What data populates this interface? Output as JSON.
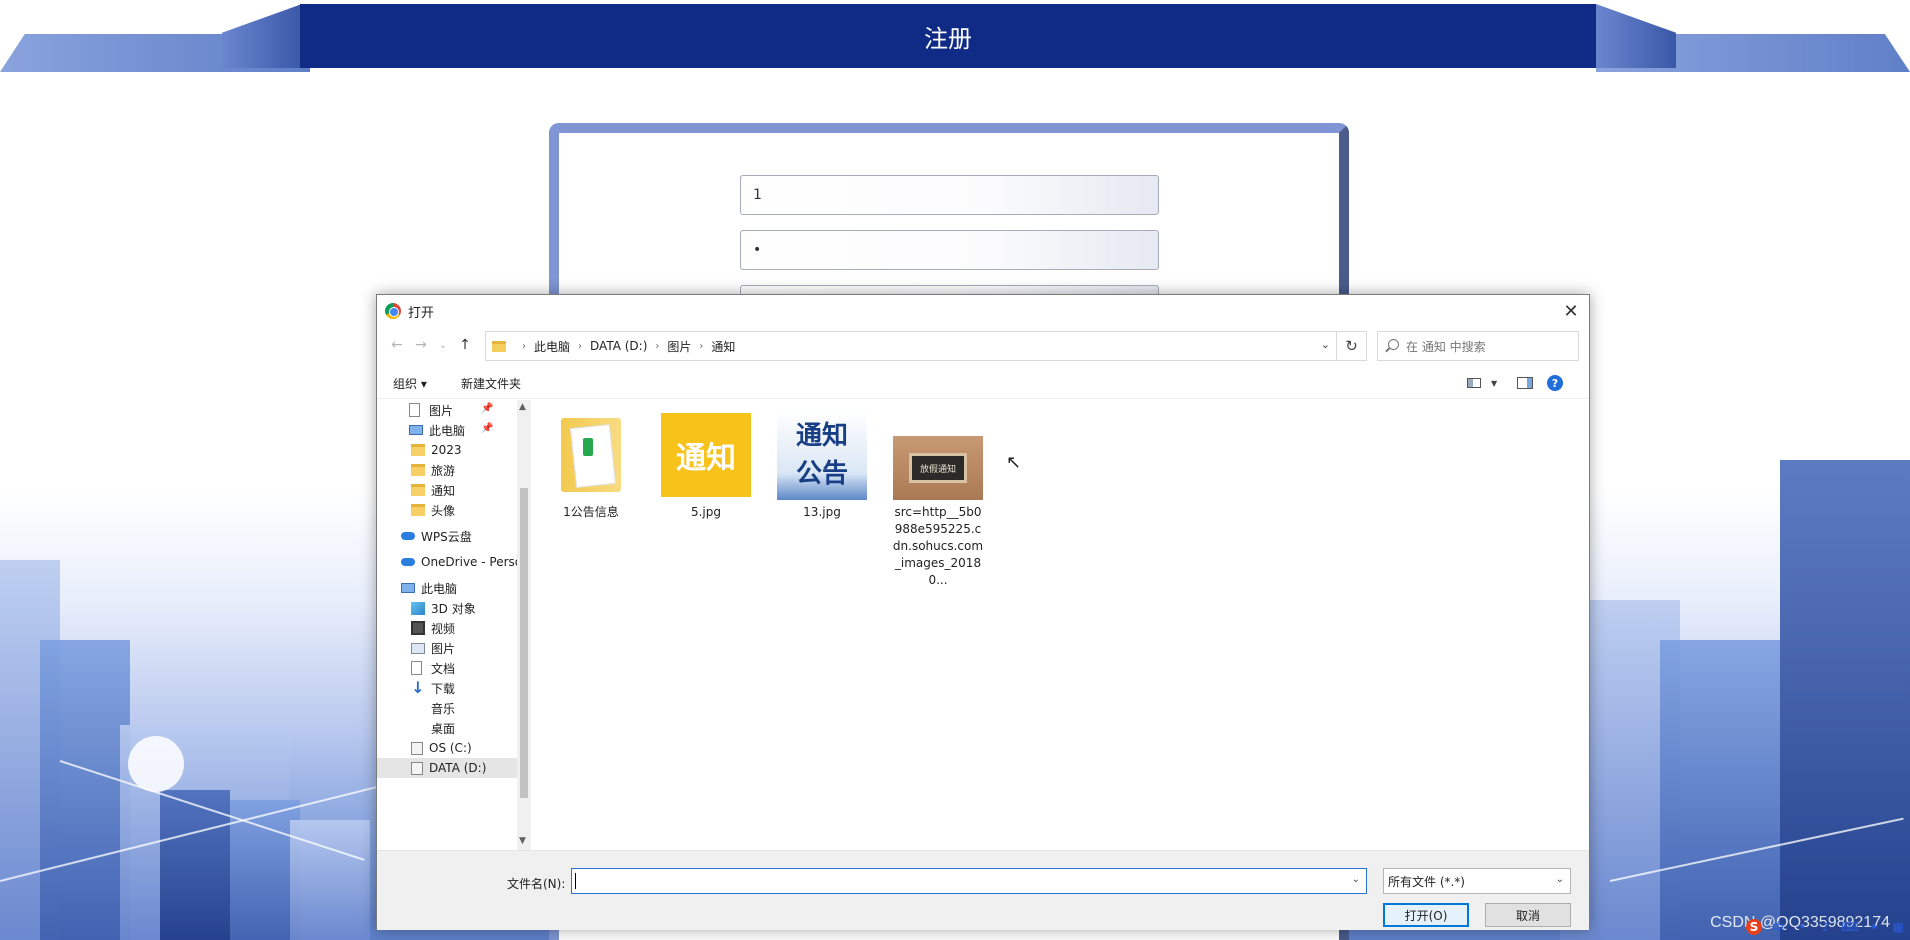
{
  "page": {
    "title": "注册",
    "fields": [
      {
        "value": "1"
      },
      {
        "value": "•"
      },
      {
        "value": ""
      }
    ],
    "watermark": "CSDN @QQ3359892174"
  },
  "dialog": {
    "title": "打开",
    "close_glyph": "✕",
    "nav": {
      "back": "←",
      "forward": "→",
      "recent": "⌄",
      "up": "↑",
      "refresh": "↻"
    },
    "breadcrumb": [
      "此电脑",
      "DATA (D:)",
      "图片",
      "通知"
    ],
    "search_placeholder": "在 通知 中搜索",
    "toolbar": {
      "organize": "组织 ▾",
      "new_folder": "新建文件夹"
    },
    "sidebar": [
      {
        "label": "图片",
        "icon": "document-icon",
        "pinned": true
      },
      {
        "label": "此电脑",
        "icon": "computer-icon",
        "pinned": true
      },
      {
        "label": "2023",
        "icon": "folder-icon"
      },
      {
        "label": "旅游",
        "icon": "folder-icon"
      },
      {
        "label": "通知",
        "icon": "folder-icon"
      },
      {
        "label": "头像",
        "icon": "folder-icon"
      },
      {
        "label": "WPS云盘",
        "icon": "cloud-icon"
      },
      {
        "label": "OneDrive - Perso",
        "icon": "cloud-icon"
      },
      {
        "label": "此电脑",
        "icon": "computer-icon"
      },
      {
        "label": "3D 对象",
        "icon": "cube-icon"
      },
      {
        "label": "视频",
        "icon": "video-icon"
      },
      {
        "label": "图片",
        "icon": "pictures-icon"
      },
      {
        "label": "文档",
        "icon": "document-icon"
      },
      {
        "label": "下载",
        "icon": "download-icon"
      },
      {
        "label": "音乐",
        "icon": "music-icon"
      },
      {
        "label": "桌面",
        "icon": "desktop-icon"
      },
      {
        "label": "OS (C:)",
        "icon": "drive-icon"
      },
      {
        "label": "DATA (D:)",
        "icon": "drive-icon",
        "selected": true
      }
    ],
    "files": [
      {
        "name": "1公告信息",
        "kind": "folder"
      },
      {
        "name": "5.jpg",
        "kind": "image",
        "image_text": "通知"
      },
      {
        "name": "13.jpg",
        "kind": "image",
        "image_text": "通知公告"
      },
      {
        "name": "src=http__5b0988e595225.cdn.sohucs.com_images_20180...",
        "kind": "image",
        "image_text": "放假通知"
      }
    ],
    "filename_label": "文件名(N):",
    "filename_value": "",
    "filetype": "所有文件 (*.*)",
    "open_button": "打开(O)",
    "cancel_button": "取消"
  },
  "colors": {
    "header": "#0f2b85",
    "accent": "#0078d7"
  }
}
